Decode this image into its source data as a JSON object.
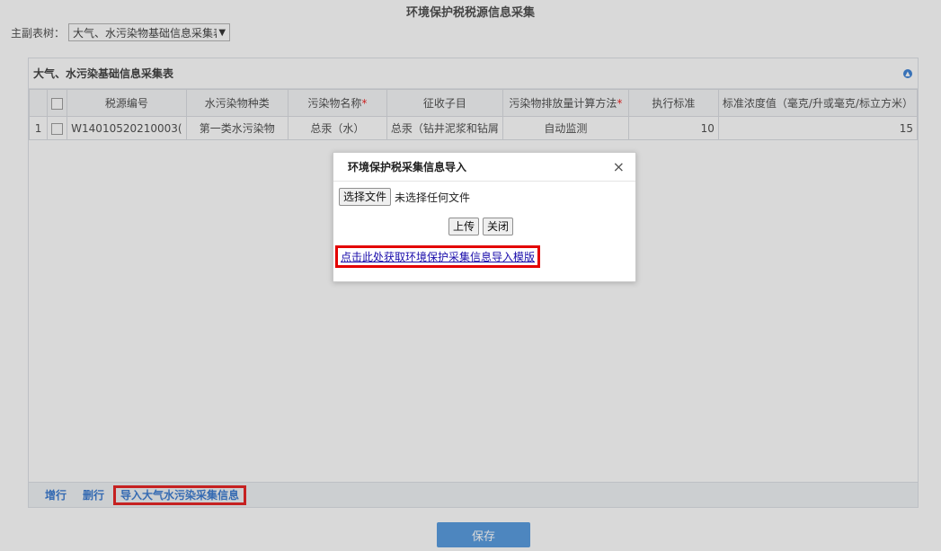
{
  "page": {
    "title": "环境保护税税源信息采集"
  },
  "tree": {
    "label": "主副表树：",
    "selected": "大气、水污染物基础信息采集表"
  },
  "panel": {
    "title": "大气、水污染基础信息采集表",
    "columns": [
      "税源编号",
      "水污染物种类",
      "污染物名称",
      "征收子目",
      "污染物排放量计算方法",
      "执行标准",
      "标准浓度值（毫克/升或毫克/标立方米）"
    ],
    "required_mark": "*",
    "rows": [
      {
        "num": "1",
        "source_id": "W14010520210003(",
        "pollutant_type": "第一类水污染物",
        "pollutant_name": "总汞（水）",
        "sub_item": "总汞（钻井泥浆和钻屑",
        "method": "自动监测",
        "standard": "10",
        "concentration": "15"
      }
    ]
  },
  "toolbar": {
    "add": "增行",
    "delete": "删行",
    "import": "导入大气水污染采集信息"
  },
  "save_label": "保存",
  "dialog": {
    "title": "环境保护税采集信息导入",
    "close": "×",
    "choose_file": "选择文件",
    "file_status": "未选择任何文件",
    "upload": "上传",
    "close_btn": "关闭",
    "template_link": "点击此处获取环境保护采集信息导入模版"
  },
  "colors": {
    "accent": "#3d8ddc",
    "highlight": "#e30000",
    "link": "#1b66c9"
  }
}
